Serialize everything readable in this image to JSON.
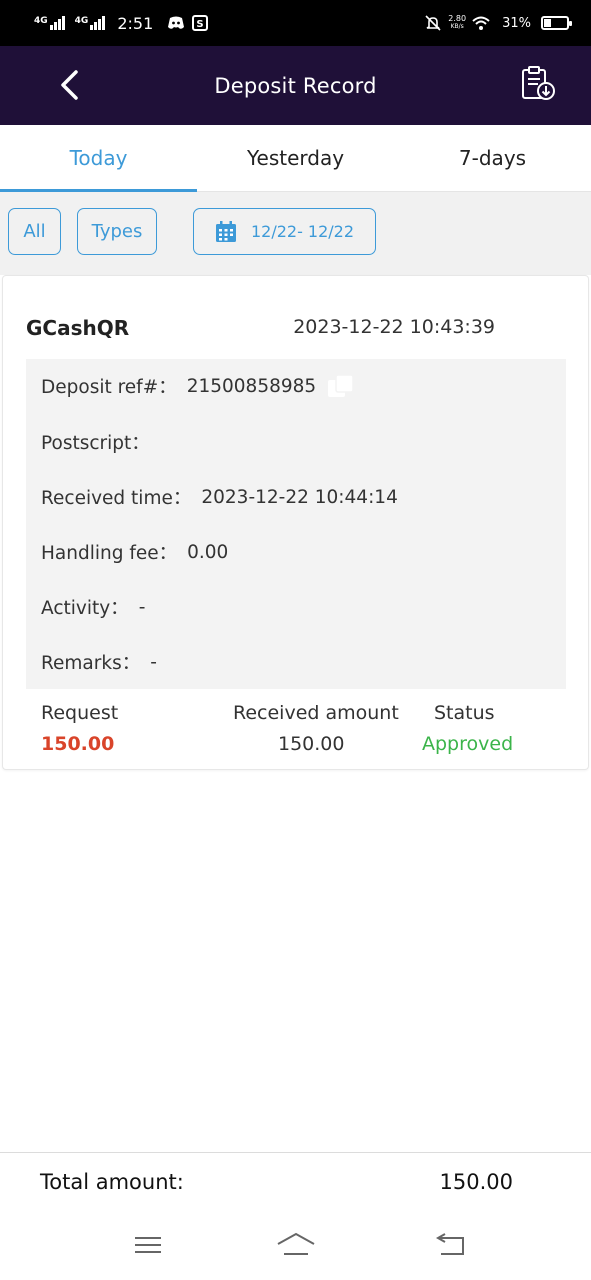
{
  "status_bar": {
    "network1": "4G",
    "network2": "4G",
    "time": "2:51",
    "speed_value": "2.80",
    "speed_unit": "KB/s",
    "battery": "31%"
  },
  "header": {
    "title": "Deposit Record"
  },
  "tabs": [
    {
      "label": "Today",
      "active": true
    },
    {
      "label": "Yesterday",
      "active": false
    },
    {
      "label": "7-days",
      "active": false
    }
  ],
  "filters": {
    "all_label": "All",
    "types_label": "Types",
    "date_range": "12/22- 12/22"
  },
  "record": {
    "method": "GCashQR",
    "datetime": "2023-12-22 10:43:39",
    "details": [
      {
        "label": "Deposit ref#：",
        "value": "21500858985"
      },
      {
        "label": "Postscript：",
        "value": ""
      },
      {
        "label": "Received time：",
        "value": "2023-12-22 10:44:14"
      },
      {
        "label": "Handling fee：",
        "value": "0.00"
      },
      {
        "label": "Activity：",
        "value": "-"
      },
      {
        "label": "Remarks：",
        "value": "-"
      }
    ],
    "summary": {
      "request_label": "Request",
      "request_value": "150.00",
      "received_label": "Received amount",
      "received_value": "150.00",
      "status_label": "Status",
      "status_value": "Approved"
    }
  },
  "footer": {
    "total_label": "Total amount:",
    "total_value": "150.00"
  },
  "colors": {
    "header_bg": "#1f1038",
    "accent": "#3d9ad8",
    "request_red": "#d9442a",
    "approved_green": "#3bb44a"
  }
}
